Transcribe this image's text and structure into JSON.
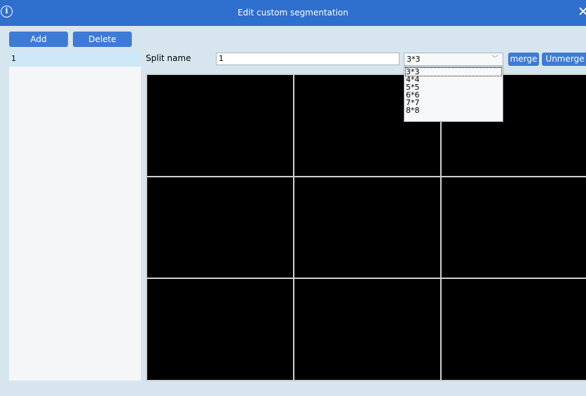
{
  "window": {
    "title": "Edit custom segmentation"
  },
  "toolbar": {
    "add_label": "Add",
    "delete_label": "Delete"
  },
  "list": {
    "items": [
      "1"
    ]
  },
  "form": {
    "split_name_label": "Split name",
    "split_name_value": "1",
    "layout_value": "3*3",
    "merge_label": "merge",
    "unmerge_label": "Unmerge"
  },
  "dropdown": {
    "options": [
      "3*3",
      "4*4",
      "5*5",
      "6*6",
      "7*7",
      "8*8"
    ]
  },
  "grid": {
    "rows": 3,
    "cols": 3
  },
  "colors": {
    "titlebar": "#2f6fcd",
    "button": "#3e7bd6",
    "background": "#d7e6ee",
    "cell": "#000000"
  }
}
